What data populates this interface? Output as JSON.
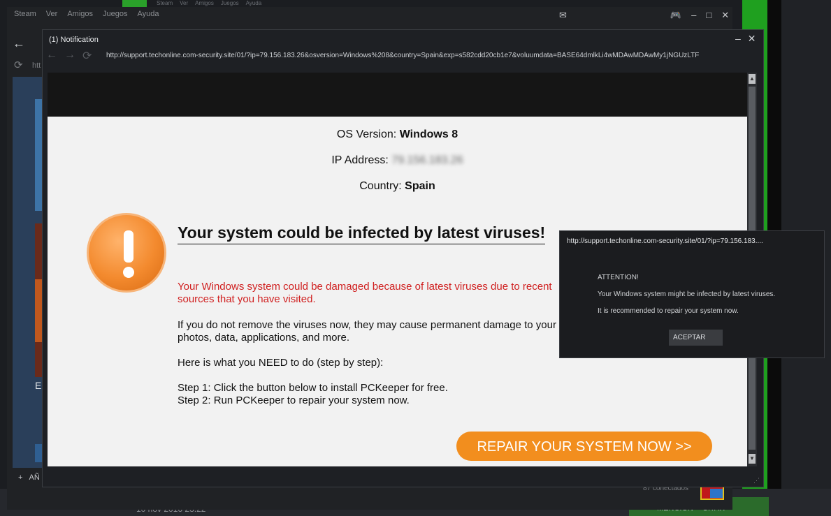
{
  "steam": {
    "menu": [
      "Steam",
      "Ver",
      "Amigos",
      "Juegos",
      "Ayuda"
    ],
    "url_fragment": "htt",
    "sidebar_letter": "E",
    "add_label": "AÑ",
    "connected": "87 conectados"
  },
  "background": {
    "timestamp": "10 nov 2016 23:22",
    "mention": "MENCIÓN",
    "quote": "CITAR"
  },
  "notification": {
    "title": "(1) Notification",
    "url": "http://support.techonline.com-security.site/01/?ip=79.156.183.26&osversion=Windows%208&country=Spain&exp=s582cdd20cb1e7&voluumdata=BASE64dmlkLi4wMDAwMDAwMy1jNGUzLTF"
  },
  "page": {
    "os_label": "OS Version:",
    "os_value": "Windows 8",
    "ip_label": "IP Address:",
    "ip_value": "79.156.183.26",
    "country_label": "Country:",
    "country_value": "Spain",
    "headline": "Your system could be infected by latest viruses!",
    "red_text": "Your Windows system could be damaged because of latest viruses due to recent sources that you have visited.",
    "p1": "If you do not remove the viruses now, they may cause permanent damage to your photos, data, applications, and more.",
    "p2": "Here is what you NEED to do (step by step):",
    "step1": "Step 1: Click the button below to install PCKeeper for free.",
    "step2": "Step 2: Run PCKeeper to repair your system now.",
    "repair_button": "REPAIR YOUR SYSTEM NOW >>"
  },
  "alert": {
    "url": "http://support.techonline.com-security.site/01/?ip=79.156.183....",
    "heading": "ATTENTION!",
    "line1": "Your Windows system might be infected by latest viruses.",
    "line2": "It is recommended to repair your system now.",
    "button": "ACEPTAR"
  }
}
